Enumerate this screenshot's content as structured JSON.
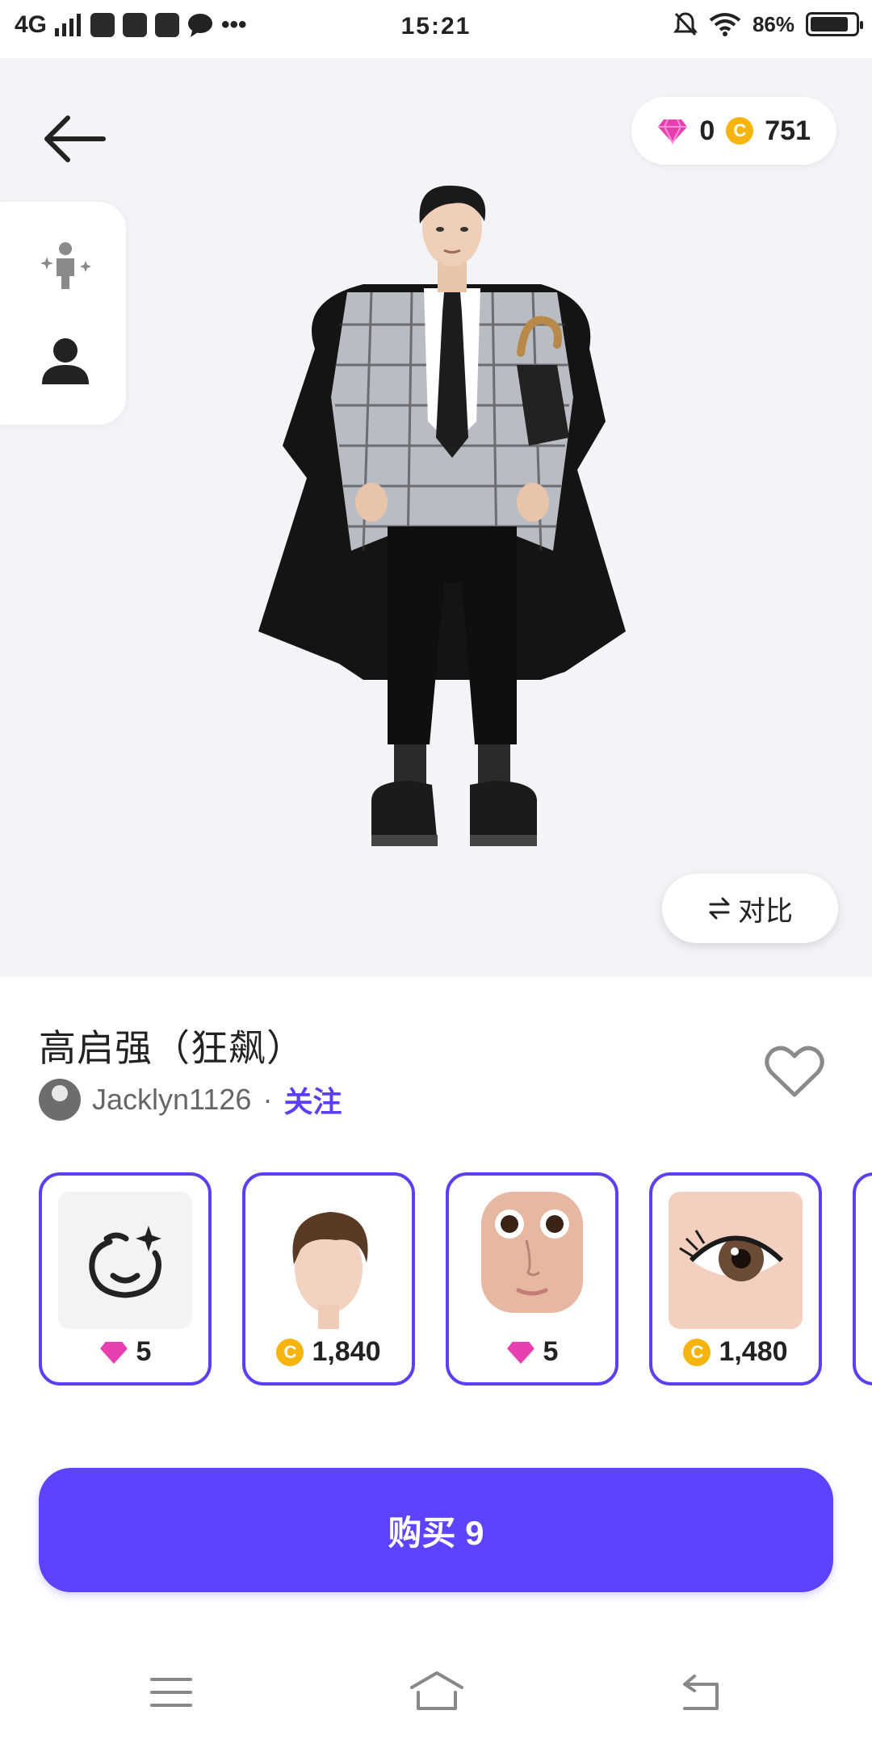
{
  "status_bar": {
    "network": "4G",
    "time": "15:21",
    "battery": "86%",
    "battery_level": 0.86
  },
  "wallet": {
    "gems": "0",
    "coins": "751"
  },
  "stage": {
    "compare_label": "对比"
  },
  "outfit": {
    "title": "高启强（狂飙）",
    "author": "Jacklyn1126",
    "separator": "·",
    "follow_label": "关注"
  },
  "items": [
    {
      "name": "face-template",
      "currency": "gem",
      "price": "5"
    },
    {
      "name": "hair",
      "currency": "coin",
      "price": "1,840"
    },
    {
      "name": "face",
      "currency": "gem",
      "price": "5"
    },
    {
      "name": "eye",
      "currency": "coin",
      "price": "1,480"
    }
  ],
  "buy": {
    "label": "购买 9"
  },
  "colors": {
    "accent": "#5b43ff",
    "gem": "#e83fb0",
    "coin": "#f5b40e"
  },
  "icons": {
    "back": "arrow-left-icon",
    "body": "body-sparkle-icon",
    "head": "head-icon",
    "heart": "heart-outline-icon",
    "compare": "swap-icon",
    "nav_menu": "menu-icon",
    "nav_home": "home-icon",
    "nav_back": "return-icon"
  }
}
